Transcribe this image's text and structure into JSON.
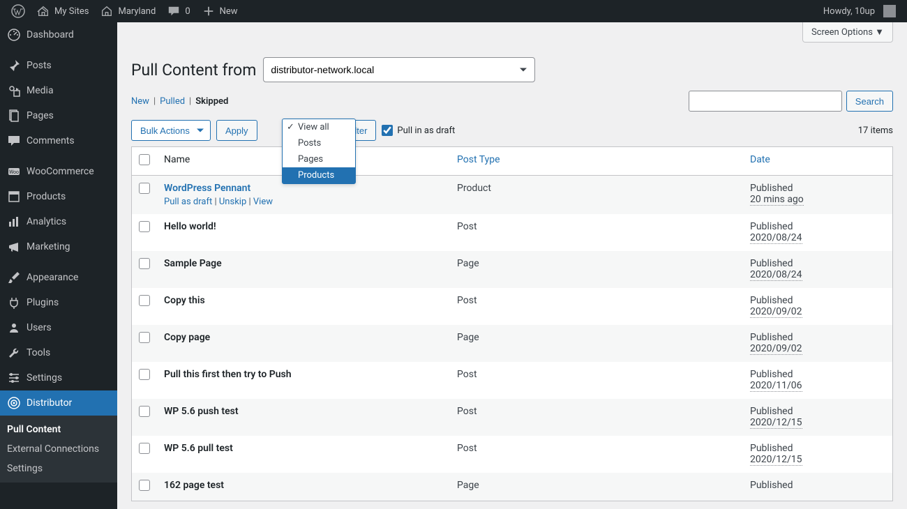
{
  "adminbar": {
    "mysites": "My Sites",
    "sitename": "Maryland",
    "comments": "0",
    "new": "New",
    "howdy": "Howdy, 10up"
  },
  "sidebar": {
    "items": [
      {
        "label": "Dashboard",
        "icon": "dashboard"
      },
      {
        "label": "Posts",
        "icon": "pin"
      },
      {
        "label": "Media",
        "icon": "media"
      },
      {
        "label": "Pages",
        "icon": "pages"
      },
      {
        "label": "Comments",
        "icon": "comments"
      },
      {
        "label": "WooCommerce",
        "icon": "woo"
      },
      {
        "label": "Products",
        "icon": "products"
      },
      {
        "label": "Analytics",
        "icon": "analytics"
      },
      {
        "label": "Marketing",
        "icon": "marketing"
      },
      {
        "label": "Appearance",
        "icon": "appearance"
      },
      {
        "label": "Plugins",
        "icon": "plugins"
      },
      {
        "label": "Users",
        "icon": "users"
      },
      {
        "label": "Tools",
        "icon": "tools"
      },
      {
        "label": "Settings",
        "icon": "settings"
      },
      {
        "label": "Distributor",
        "icon": "distributor",
        "current": true
      }
    ],
    "submenu": {
      "pull": "Pull Content",
      "external": "External Connections",
      "settings": "Settings"
    }
  },
  "screen_options": "Screen Options ▼",
  "page": {
    "title": "Pull Content from",
    "source": "distributor-network.local",
    "tabs": {
      "new": "New",
      "pulled": "Pulled",
      "skipped": "Skipped"
    },
    "bulk_label": "Bulk Actions",
    "apply": "Apply",
    "filter": "Filter",
    "pull_as_draft": "Pull in as draft",
    "search": "Search",
    "items_count": "17 items"
  },
  "type_dropdown": {
    "view_all": "View all",
    "posts": "Posts",
    "pages": "Pages",
    "products": "Products"
  },
  "columns": {
    "name": "Name",
    "post_type": "Post Type",
    "date": "Date"
  },
  "row_actions": {
    "pull_as_draft": "Pull as draft",
    "unskip": "Unskip",
    "view": "View"
  },
  "rows": [
    {
      "title": "WordPress Pennant",
      "type": "Product",
      "status": "Published",
      "date": "20 mins ago",
      "actions": true
    },
    {
      "title": "Hello world!",
      "type": "Post",
      "status": "Published",
      "date": "2020/08/24"
    },
    {
      "title": "Sample Page",
      "type": "Page",
      "status": "Published",
      "date": "2020/08/24"
    },
    {
      "title": "Copy this",
      "type": "Post",
      "status": "Published",
      "date": "2020/09/02"
    },
    {
      "title": "Copy page",
      "type": "Page",
      "status": "Published",
      "date": "2020/09/02"
    },
    {
      "title": "Pull this first then try to Push",
      "type": "Post",
      "status": "Published",
      "date": "2020/11/06"
    },
    {
      "title": "WP 5.6 push test",
      "type": "Post",
      "status": "Published",
      "date": "2020/12/15"
    },
    {
      "title": "WP 5.6 pull test",
      "type": "Post",
      "status": "Published",
      "date": "2020/12/15"
    },
    {
      "title": "162 page test",
      "type": "Page",
      "status": "Published",
      "date": ""
    }
  ]
}
